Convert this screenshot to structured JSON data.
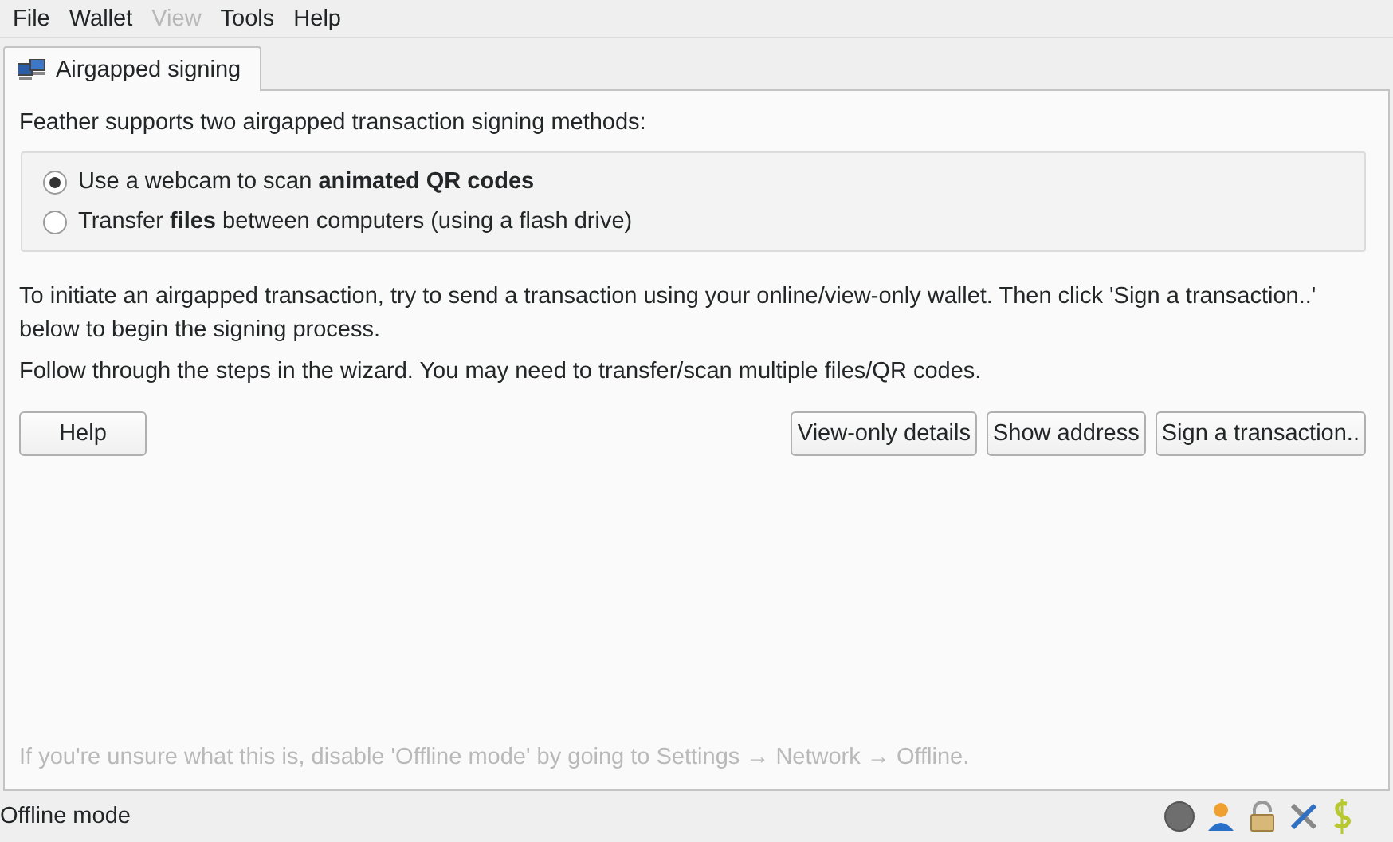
{
  "menu": [
    {
      "label": "File",
      "disabled": false
    },
    {
      "label": "Wallet",
      "disabled": false
    },
    {
      "label": "View",
      "disabled": true
    },
    {
      "label": "Tools",
      "disabled": false
    },
    {
      "label": "Help",
      "disabled": false
    }
  ],
  "tabs": [
    {
      "label": "Airgapped signing",
      "selected": true
    }
  ],
  "intro": "Feather supports two airgapped transaction signing methods:",
  "methods": [
    {
      "label": "Use a webcam to scan **animated QR codes**",
      "selected": true
    },
    {
      "label": "Transfer **files** between computers (using a flash drive)",
      "selected": false
    }
  ],
  "paragraphs": [
    "To initiate an airgapped transaction, try to send a transaction using your online/view-only wallet. Then click 'Sign a transaction..' below to begin the signing process.",
    "Follow through the steps in the wizard. You may need to transfer/scan multiple files/QR codes."
  ],
  "left_buttons": [
    "Help"
  ],
  "right_buttons": [
    "View-only details",
    "Show address",
    "Sign a transaction.."
  ],
  "hint": "If you're unsure what this is, disable 'Offline mode' by going to Settings → Network → Offline.",
  "status_bar": {
    "text": "Offline mode"
  }
}
